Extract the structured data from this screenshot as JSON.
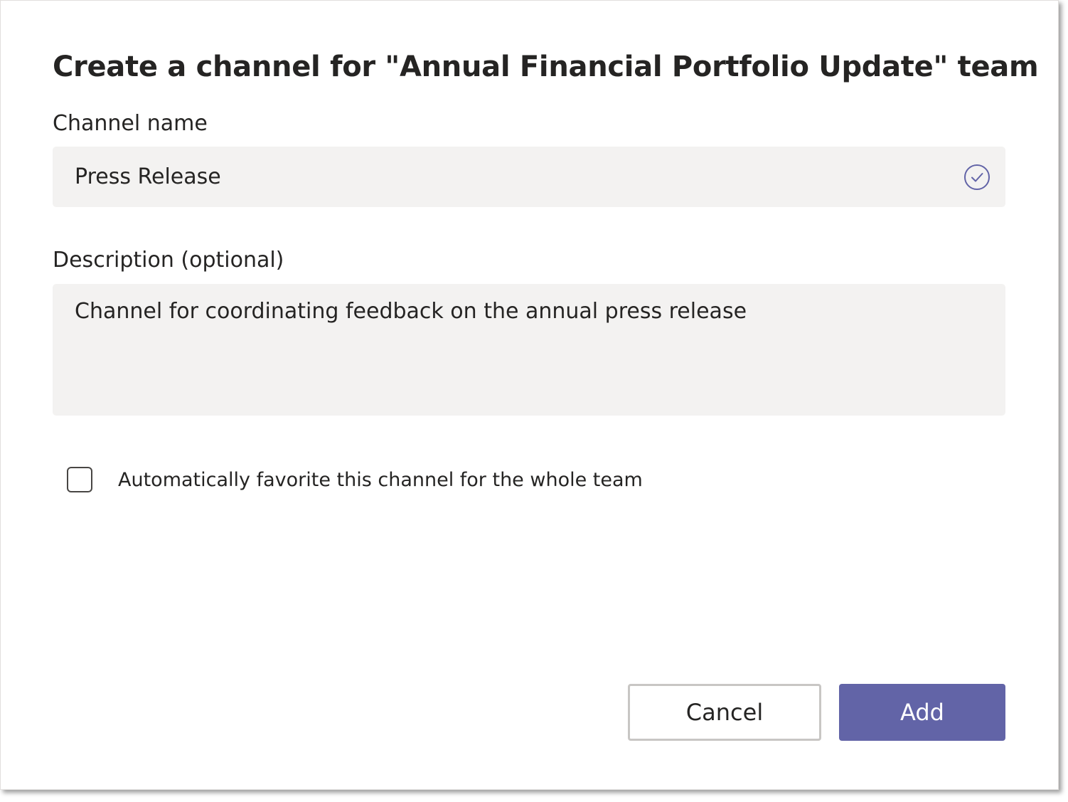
{
  "dialog": {
    "title": "Create a channel for \"Annual Financial Portfolio Update\" team",
    "channel_name": {
      "label": "Channel name",
      "value": "Press Release",
      "status_icon": "check-circle-icon",
      "status_color": "#6264a7"
    },
    "description": {
      "label": "Description (optional)",
      "value": "Channel for coordinating feedback on the annual press release"
    },
    "auto_favorite": {
      "label": "Automatically favorite this channel for the whole team",
      "checked": false
    },
    "buttons": {
      "cancel_label": "Cancel",
      "add_label": "Add"
    },
    "colors": {
      "accent": "#6264a7",
      "field_background": "#f3f2f1",
      "text": "#252423"
    }
  }
}
